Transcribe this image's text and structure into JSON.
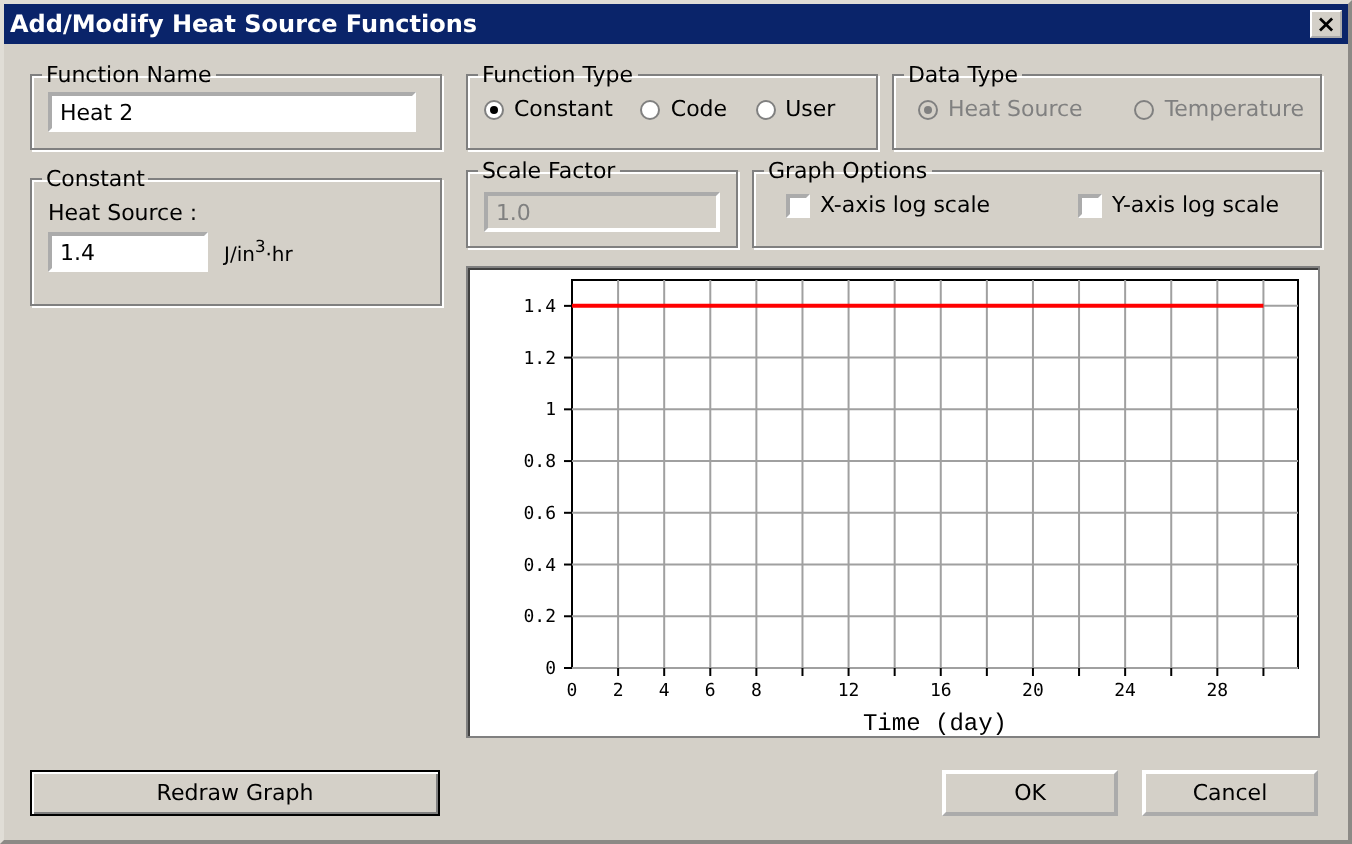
{
  "window": {
    "title": "Add/Modify Heat Source Functions",
    "close": "×"
  },
  "function_name": {
    "label": "Function Name",
    "value": "Heat 2"
  },
  "function_type": {
    "label": "Function Type",
    "options": [
      {
        "label": "Constant",
        "selected": true
      },
      {
        "label": "Code",
        "selected": false
      },
      {
        "label": "User",
        "selected": false
      }
    ]
  },
  "data_type": {
    "label": "Data Type",
    "disabled": true,
    "options": [
      {
        "label": "Heat Source",
        "selected": true
      },
      {
        "label": "Temperature",
        "selected": false
      }
    ]
  },
  "constant": {
    "label": "Constant",
    "field_label": "Heat Source :",
    "value": "1.4",
    "unit": "J/in$^{3}$·hr"
  },
  "scale_factor": {
    "label": "Scale Factor",
    "value": "1.0",
    "disabled": true
  },
  "graph_options": {
    "label": "Graph Options",
    "options": [
      {
        "label": "X-axis log scale",
        "checked": false
      },
      {
        "label": "Y-axis log scale",
        "checked": false
      }
    ]
  },
  "chart_data": {
    "type": "line",
    "grid": true,
    "xlabel": "Time (day)",
    "xlim": [
      0,
      31.5
    ],
    "ylim": [
      0,
      1.5
    ],
    "xticks": [
      0,
      2,
      4,
      6,
      8,
      12,
      16,
      20,
      24,
      28
    ],
    "yticks": [
      0,
      0.2,
      0.4,
      0.6,
      0.8,
      1,
      1.2,
      1.4
    ],
    "x": [
      0,
      30
    ],
    "series": [
      {
        "color": "#ff0000",
        "values": [
          1.4,
          1.4
        ]
      }
    ]
  },
  "buttons": {
    "redraw": "Redraw Graph",
    "ok": "OK",
    "cancel": "Cancel"
  }
}
